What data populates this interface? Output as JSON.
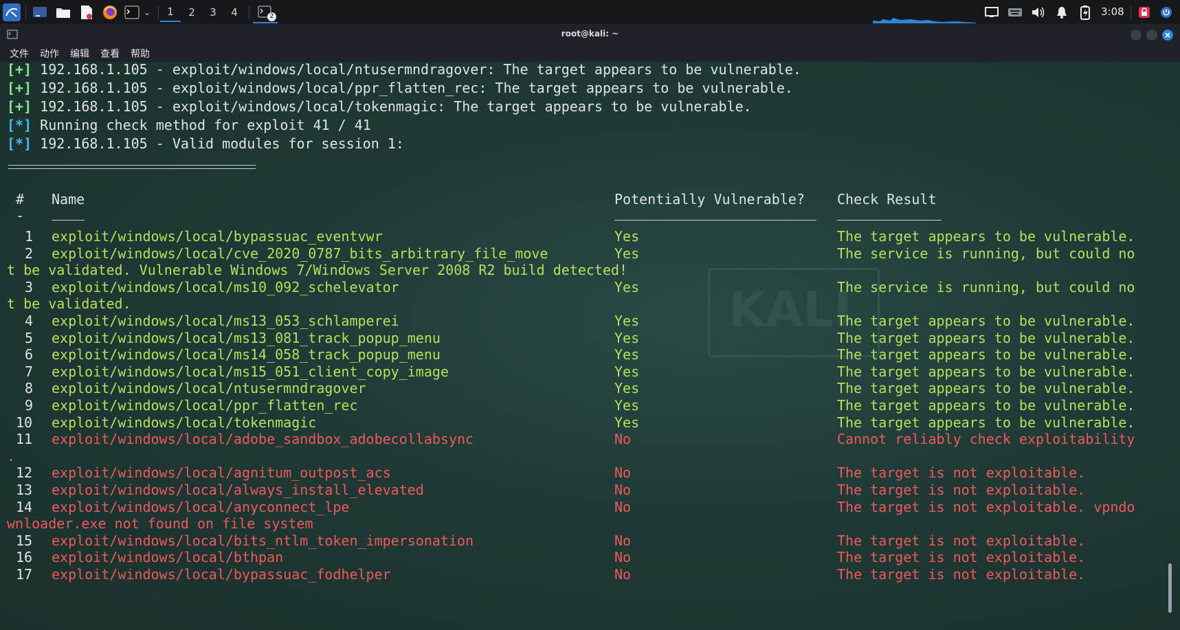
{
  "taskbar": {
    "workspaces": [
      "1",
      "2",
      "3",
      "4"
    ],
    "active_workspace": "1",
    "terminal_badge": "2",
    "clock": "3:08",
    "icons": [
      "kali-menu-icon",
      "show-desktop-icon",
      "file-manager-icon",
      "text-editor-icon",
      "firefox-icon",
      "terminal-icon",
      "chevron-down-icon",
      "terminal-task-icon",
      "screen-icon",
      "keyboard-icon",
      "volume-icon",
      "bell-icon",
      "battery-icon",
      "lock-icon",
      "power-icon"
    ]
  },
  "window": {
    "title": "root@kali: ~",
    "menu": [
      "文件",
      "动作",
      "编辑",
      "查看",
      "帮助"
    ]
  },
  "terminal": {
    "messages": [
      {
        "tag": "[+]",
        "text": " 192.168.1.105 - exploit/windows/local/ntusermndragover: The target appears to be vulnerable."
      },
      {
        "tag": "[+]",
        "text": " 192.168.1.105 - exploit/windows/local/ppr_flatten_rec: The target appears to be vulnerable."
      },
      {
        "tag": "[+]",
        "text": " 192.168.1.105 - exploit/windows/local/tokenmagic: The target appears to be vulnerable."
      },
      {
        "tag": "[*]",
        "text": " Running check method for exploit 41 / 41"
      },
      {
        "tag": "[*]",
        "text": " 192.168.1.105 - Valid modules for session 1:"
      }
    ],
    "table": {
      "headers": {
        "num": "#",
        "name": "Name",
        "vuln": "Potentially Vulnerable?",
        "result": "Check Result"
      },
      "header_dash": "-",
      "rows": [
        {
          "num": "1",
          "name": "exploit/windows/local/bypassuac_eventvwr",
          "vuln": "Yes",
          "result": "The target appears to be vulnerable.",
          "wrap": "",
          "color": "green"
        },
        {
          "num": "2",
          "name": "exploit/windows/local/cve_2020_0787_bits_arbitrary_file_move",
          "vuln": "Yes",
          "result": "The service is running, but could no",
          "wrap": "t be validated. Vulnerable Windows 7/Windows Server 2008 R2 build detected!",
          "color": "green"
        },
        {
          "num": "3",
          "name": "exploit/windows/local/ms10_092_schelevator",
          "vuln": "Yes",
          "result": "The service is running, but could no",
          "wrap": "t be validated.",
          "color": "green"
        },
        {
          "num": "4",
          "name": "exploit/windows/local/ms13_053_schlamperei",
          "vuln": "Yes",
          "result": "The target appears to be vulnerable.",
          "wrap": "",
          "color": "green"
        },
        {
          "num": "5",
          "name": "exploit/windows/local/ms13_081_track_popup_menu",
          "vuln": "Yes",
          "result": "The target appears to be vulnerable.",
          "wrap": "",
          "color": "green"
        },
        {
          "num": "6",
          "name": "exploit/windows/local/ms14_058_track_popup_menu",
          "vuln": "Yes",
          "result": "The target appears to be vulnerable.",
          "wrap": "",
          "color": "green"
        },
        {
          "num": "7",
          "name": "exploit/windows/local/ms15_051_client_copy_image",
          "vuln": "Yes",
          "result": "The target appears to be vulnerable.",
          "wrap": "",
          "color": "green"
        },
        {
          "num": "8",
          "name": "exploit/windows/local/ntusermndragover",
          "vuln": "Yes",
          "result": "The target appears to be vulnerable.",
          "wrap": "",
          "color": "green"
        },
        {
          "num": "9",
          "name": "exploit/windows/local/ppr_flatten_rec",
          "vuln": "Yes",
          "result": "The target appears to be vulnerable.",
          "wrap": "",
          "color": "green"
        },
        {
          "num": "10",
          "name": "exploit/windows/local/tokenmagic",
          "vuln": "Yes",
          "result": "The target appears to be vulnerable.",
          "wrap": "",
          "color": "green"
        },
        {
          "num": "11",
          "name": "exploit/windows/local/adobe_sandbox_adobecollabsync",
          "vuln": "No",
          "result": "Cannot reliably check exploitability",
          "wrap": ".",
          "color": "red"
        },
        {
          "num": "12",
          "name": "exploit/windows/local/agnitum_outpost_acs",
          "vuln": "No",
          "result": "The target is not exploitable.",
          "wrap": "",
          "color": "red"
        },
        {
          "num": "13",
          "name": "exploit/windows/local/always_install_elevated",
          "vuln": "No",
          "result": "The target is not exploitable.",
          "wrap": "",
          "color": "red"
        },
        {
          "num": "14",
          "name": "exploit/windows/local/anyconnect_lpe",
          "vuln": "No",
          "result": "The target is not exploitable. vpndo",
          "wrap": "wnloader.exe not found on file system",
          "color": "red"
        },
        {
          "num": "15",
          "name": "exploit/windows/local/bits_ntlm_token_impersonation",
          "vuln": "No",
          "result": "The target is not exploitable.",
          "wrap": "",
          "color": "red"
        },
        {
          "num": "16",
          "name": "exploit/windows/local/bthpan",
          "vuln": "No",
          "result": "The target is not exploitable.",
          "wrap": "",
          "color": "red"
        },
        {
          "num": "17",
          "name": "exploit/windows/local/bypassuac_fodhelper",
          "vuln": "No",
          "result": "The target is not exploitable.",
          "wrap": "",
          "color": "red"
        }
      ]
    },
    "colors": {
      "ok": "#b6e05b",
      "bad": "#f1585a",
      "plus": "#8ee38e",
      "star": "#4fb6f0"
    }
  }
}
